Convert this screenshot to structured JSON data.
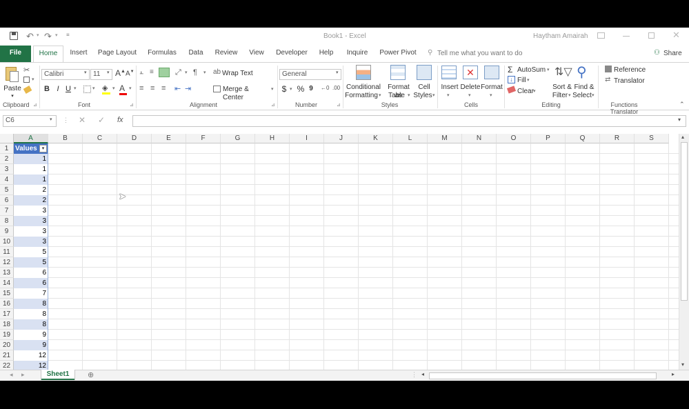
{
  "titlebar": {
    "doc_title": "Book1  -  Excel",
    "user": "Haytham Amairah"
  },
  "tabs": [
    "File",
    "Home",
    "Insert",
    "Page Layout",
    "Formulas",
    "Data",
    "Review",
    "View",
    "Developer",
    "Help",
    "Inquire",
    "Power Pivot"
  ],
  "tell_me": "Tell me what you want to do",
  "share": "Share",
  "ribbon": {
    "clipboard": {
      "paste": "Paste",
      "label": "Clipboard"
    },
    "font": {
      "name": "Calibri",
      "size": "11",
      "label": "Font",
      "bold": "B",
      "italic": "I",
      "underline": "U"
    },
    "alignment": {
      "wrap_text": "Wrap Text",
      "merge_center": "Merge & Center",
      "label": "Alignment"
    },
    "number": {
      "format": "General",
      "currency": "$",
      "percent": "%",
      "comma": "9",
      "label": "Number"
    },
    "styles": {
      "conditional": "Conditional",
      "conditional2": "Formatting",
      "format_as": "Format as",
      "format_as2": "Table",
      "cell": "Cell",
      "cell2": "Styles",
      "label": "Styles"
    },
    "cells": {
      "insert": "Insert",
      "delete": "Delete",
      "format": "Format",
      "label": "Cells"
    },
    "editing": {
      "autosum": "AutoSum",
      "fill": "Fill",
      "clear": "Clear",
      "sort": "Sort &",
      "sort2": "Filter",
      "find": "Find &",
      "find2": "Select",
      "label": "Editing"
    },
    "functions": {
      "reference": "Reference",
      "translator": "Translator",
      "label": "Functions Translator"
    }
  },
  "formula_bar": {
    "name_box": "C6",
    "fx": "fx",
    "content": ""
  },
  "columns": [
    "A",
    "B",
    "C",
    "D",
    "E",
    "F",
    "G",
    "H",
    "I",
    "J",
    "K",
    "L",
    "M",
    "N",
    "O",
    "P",
    "Q",
    "R",
    "S"
  ],
  "rows": [
    "1",
    "2",
    "3",
    "4",
    "5",
    "6",
    "7",
    "8",
    "9",
    "10",
    "11",
    "12",
    "13",
    "14",
    "15",
    "16",
    "17",
    "18",
    "19",
    "20",
    "21",
    "22"
  ],
  "column_a": [
    "Values",
    "1",
    "1",
    "1",
    "2",
    "2",
    "3",
    "3",
    "3",
    "3",
    "5",
    "5",
    "6",
    "6",
    "7",
    "8",
    "8",
    "8",
    "9",
    "9",
    "12",
    "12"
  ],
  "sheet": {
    "name": "Sheet1"
  },
  "colors": {
    "accent": "#217346",
    "band": "#d9e1f2",
    "header_fill": "#4472c4"
  }
}
